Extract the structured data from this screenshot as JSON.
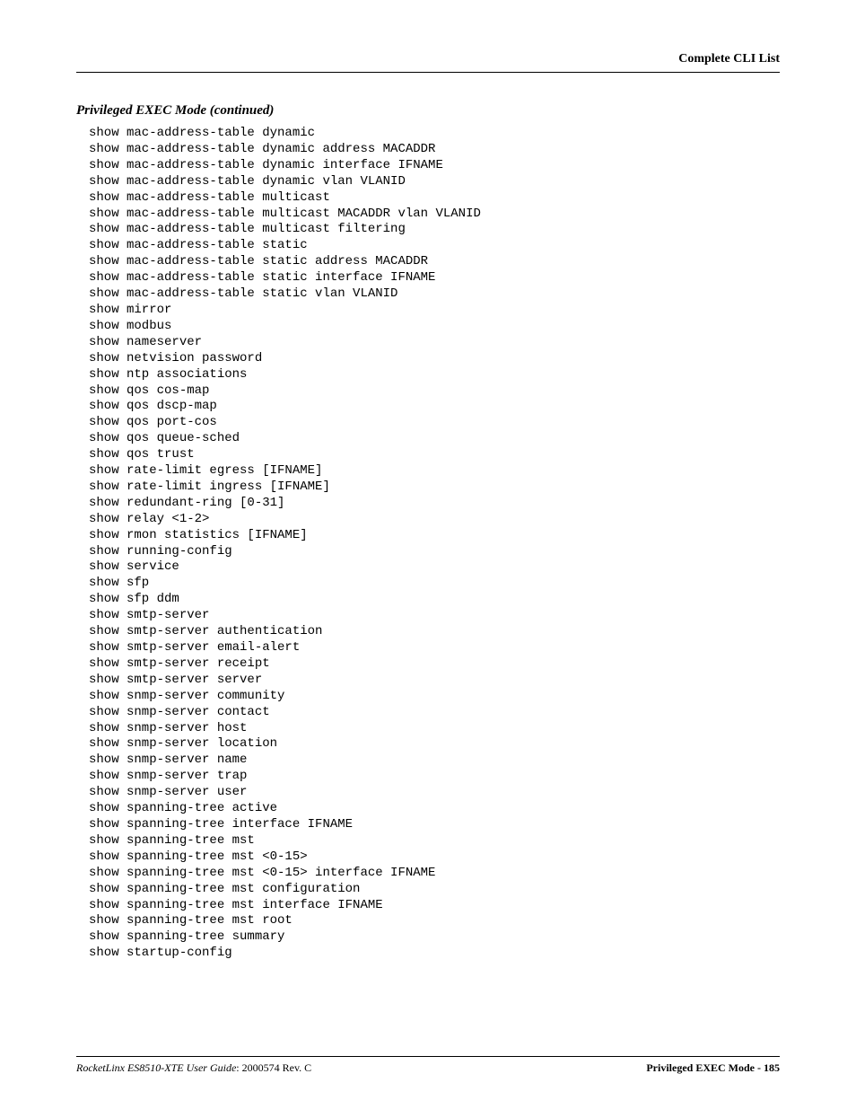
{
  "header": {
    "right": "Complete CLI List"
  },
  "section": {
    "heading": "Privileged EXEC Mode (continued)"
  },
  "commands": [
    "show mac-address-table dynamic",
    "show mac-address-table dynamic address MACADDR",
    "show mac-address-table dynamic interface IFNAME",
    "show mac-address-table dynamic vlan VLANID",
    "show mac-address-table multicast",
    "show mac-address-table multicast MACADDR vlan VLANID",
    "show mac-address-table multicast filtering",
    "show mac-address-table static",
    "show mac-address-table static address MACADDR",
    "show mac-address-table static interface IFNAME",
    "show mac-address-table static vlan VLANID",
    "show mirror",
    "show modbus",
    "show nameserver",
    "show netvision password",
    "show ntp associations",
    "show qos cos-map",
    "show qos dscp-map",
    "show qos port-cos",
    "show qos queue-sched",
    "show qos trust",
    "show rate-limit egress [IFNAME]",
    "show rate-limit ingress [IFNAME]",
    "show redundant-ring [0-31]",
    "show relay <1-2>",
    "show rmon statistics [IFNAME]",
    "show running-config",
    "show service",
    "show sfp",
    "show sfp ddm",
    "show smtp-server",
    "show smtp-server authentication",
    "show smtp-server email-alert",
    "show smtp-server receipt",
    "show smtp-server server",
    "show snmp-server community",
    "show snmp-server contact",
    "show snmp-server host",
    "show snmp-server location",
    "show snmp-server name",
    "show snmp-server trap",
    "show snmp-server user",
    "show spanning-tree active",
    "show spanning-tree interface IFNAME",
    "show spanning-tree mst",
    "show spanning-tree mst <0-15>",
    "show spanning-tree mst <0-15> interface IFNAME",
    "show spanning-tree mst configuration",
    "show spanning-tree mst interface IFNAME",
    "show spanning-tree mst root",
    "show spanning-tree summary",
    "show startup-config"
  ],
  "footer": {
    "left_italic": "RocketLinx ES8510-XTE User Guide",
    "left_rest": ": 2000574 Rev. C",
    "right": "Privileged EXEC Mode - 185"
  }
}
